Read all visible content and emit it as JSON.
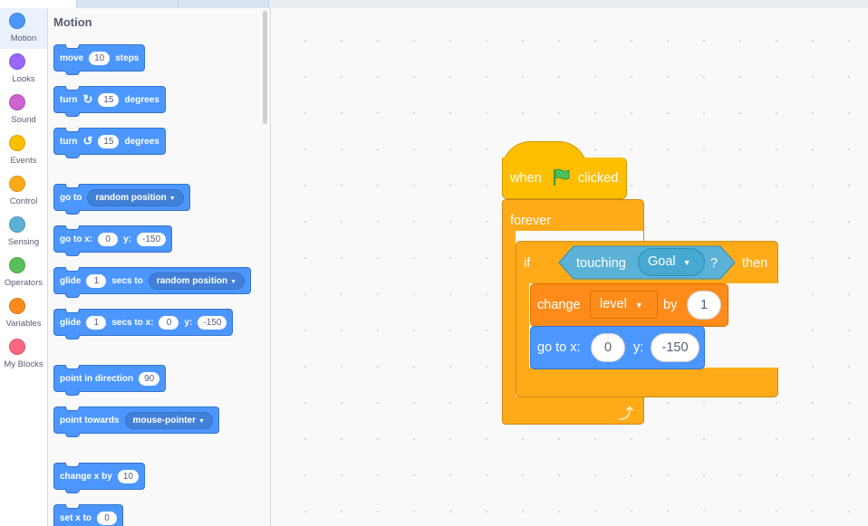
{
  "categories": [
    {
      "label": "Motion",
      "color": "#4c97ff",
      "active": true
    },
    {
      "label": "Looks",
      "color": "#9966ff"
    },
    {
      "label": "Sound",
      "color": "#cf63cf"
    },
    {
      "label": "Events",
      "color": "#ffbf00"
    },
    {
      "label": "Control",
      "color": "#ffab19"
    },
    {
      "label": "Sensing",
      "color": "#5cb1d6"
    },
    {
      "label": "Operators",
      "color": "#59c059"
    },
    {
      "label": "Variables",
      "color": "#ff8c1a"
    },
    {
      "label": "My Blocks",
      "color": "#ff6680"
    }
  ],
  "palette": {
    "title": "Motion",
    "move": {
      "word1": "move",
      "steps": "10",
      "word2": "steps"
    },
    "turn_right": {
      "word1": "turn",
      "degrees": "15",
      "word2": "degrees",
      "icon": "rotate-right-icon"
    },
    "turn_left": {
      "word1": "turn",
      "degrees": "15",
      "word2": "degrees",
      "icon": "rotate-left-icon"
    },
    "goto": {
      "word": "go to",
      "target": "random position"
    },
    "goto_xy": {
      "word1": "go to x:",
      "x": "0",
      "word2": "y:",
      "y": "-150"
    },
    "glide": {
      "word1": "glide",
      "secs": "1",
      "word2": "secs to",
      "target": "random position"
    },
    "glide_xy": {
      "word1": "glide",
      "secs": "1",
      "word2": "secs to x:",
      "x": "0",
      "word3": "y:",
      "y": "-150"
    },
    "point_dir": {
      "word": "point in direction",
      "value": "90"
    },
    "point_towards": {
      "word": "point towards",
      "target": "mouse-pointer"
    },
    "change_x": {
      "word": "change x by",
      "value": "10"
    },
    "set_x": {
      "word": "set x to",
      "value": "0"
    }
  },
  "script": {
    "hat": {
      "word1": "when",
      "word2": "clicked",
      "icon": "green-flag-icon"
    },
    "forever": {
      "label": "forever",
      "icon": "loop-arrow-icon"
    },
    "if": {
      "word1": "if",
      "word2": "then"
    },
    "touching": {
      "word1": "touching",
      "target": "Goal",
      "word2": "?"
    },
    "change": {
      "word1": "change",
      "variable": "level",
      "word2": "by",
      "value": "1"
    },
    "goto_xy": {
      "word1": "go to x:",
      "x": "0",
      "word2": "y:",
      "y": "-150"
    }
  }
}
